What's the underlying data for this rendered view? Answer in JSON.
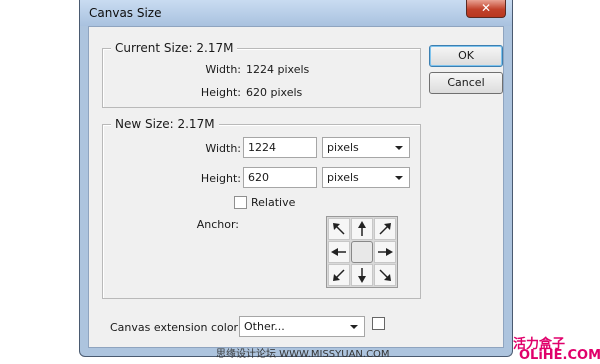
{
  "window": {
    "title": "Canvas Size",
    "close_glyph": "✕"
  },
  "current_size": {
    "label": "Current Size: 2.17M",
    "width_label": "Width:",
    "width_value": "1224 pixels",
    "height_label": "Height:",
    "height_value": "620 pixels"
  },
  "new_size": {
    "label": "New Size: 2.17M",
    "width_label": "Width:",
    "width_value": "1224",
    "width_unit": "pixels",
    "height_label": "Height:",
    "height_value": "620",
    "height_unit": "pixels",
    "relative_label": "Relative",
    "relative_checked": false,
    "anchor_label": "Anchor:"
  },
  "buttons": {
    "ok": "OK",
    "cancel": "Cancel"
  },
  "extension": {
    "label": "Canvas extension color:",
    "value": "Other...",
    "swatch_color": "#ffffff"
  },
  "watermark": {
    "text": "思缘设计论坛 WWW.MISSYUAN.COM",
    "brand_top": "活力盒子",
    "brand_bottom": "OLiHE.COM"
  },
  "icons": {
    "arrows": [
      "arrow-nw-icon",
      "arrow-n-icon",
      "arrow-ne-icon",
      "arrow-w-icon",
      "anchor-center",
      "arrow-e-icon",
      "arrow-sw-icon",
      "arrow-s-icon",
      "arrow-se-icon"
    ]
  },
  "colors": {
    "frame": "#adc4de",
    "client": "#f0f0f0",
    "close_button": "#c1412a",
    "brand": "#e0006b"
  }
}
